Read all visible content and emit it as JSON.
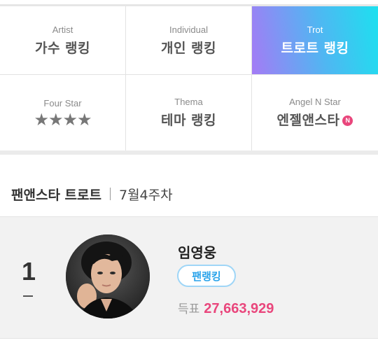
{
  "menu": {
    "items": [
      {
        "en": "Artist",
        "ko": "가수 랭킹"
      },
      {
        "en": "Individual",
        "ko": "개인 랭킹"
      },
      {
        "en": "Trot",
        "ko": "트로트 랭킹"
      },
      {
        "en": "Four Star",
        "stars": "★★★★"
      },
      {
        "en": "Thema",
        "ko": "테마 랭킹"
      },
      {
        "en": "Angel N Star",
        "ko": "엔젤앤스타",
        "badge": "N"
      }
    ],
    "active_accent": "#4fb7f2"
  },
  "section": {
    "title": "팬앤스타 트로트",
    "week": "7월4주차"
  },
  "ranking": [
    {
      "rank": "1",
      "change": "-",
      "name": "임영웅",
      "tag": "팬랭킹",
      "votes_label": "득표",
      "votes": "27,663,929"
    }
  ],
  "colors": {
    "vote_color": "#e9467c",
    "pill_color": "#29a3ea"
  }
}
